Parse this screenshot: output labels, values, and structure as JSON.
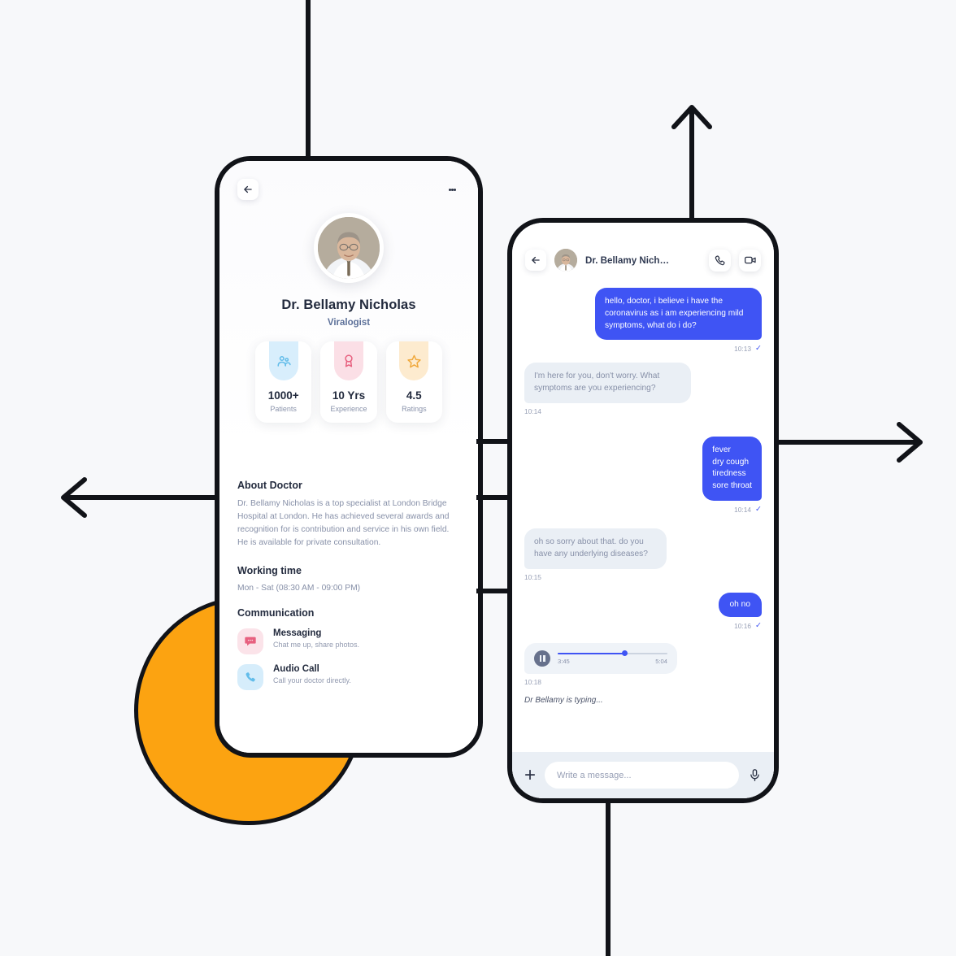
{
  "theme": {
    "background": "#f7f8fa",
    "outline": "#111318",
    "accent_blue": "#3f54f4",
    "accent_orange": "#fca311",
    "text_dark": "#232b3e",
    "text_muted": "#8790a8"
  },
  "decor": {
    "arrow_up": "arrow-up",
    "arrow_left": "arrow-left",
    "arrow_right": "arrow-right",
    "disc_shape": "pac-man-disc"
  },
  "profile_screen": {
    "back_icon": "arrow-left-icon",
    "menu_icon": "more-vertical-icon",
    "avatar": "doctor-portrait",
    "name": "Dr. Bellamy Nicholas",
    "role": "Viralogist",
    "stats": [
      {
        "icon": "people-icon",
        "icon_bg": "#d8eefc",
        "icon_color": "#63bdea",
        "value": "1000+",
        "label": "Patients"
      },
      {
        "icon": "award-icon",
        "icon_bg": "#fbdfe6",
        "icon_color": "#e7607f",
        "value": "10 Yrs",
        "label": "Experience"
      },
      {
        "icon": "star-icon",
        "icon_bg": "#fdebcf",
        "icon_color": "#f0a93d",
        "value": "4.5",
        "label": "Ratings"
      }
    ],
    "about_title": "About Doctor",
    "about_text": "Dr. Bellamy Nicholas is a top specialist at London Bridge Hospital at London. He has achieved several awards and recognition for is contribution and service in his own field. He is available for private consultation.",
    "working_title": "Working time",
    "working_text": "Mon - Sat (08:30 AM - 09:00 PM)",
    "communication_title": "Communication",
    "communication": [
      {
        "icon": "chat-bubble-icon",
        "icon_bg": "#fbe3e9",
        "icon_color": "#e7607f",
        "title": "Messaging",
        "desc": "Chat me up, share photos."
      },
      {
        "icon": "phone-icon",
        "icon_bg": "#d6edfb",
        "icon_color": "#63bdea",
        "title": "Audio Call",
        "desc": "Call your doctor directly."
      }
    ]
  },
  "chat_screen": {
    "back_icon": "arrow-left-icon",
    "avatar": "doctor-portrait",
    "contact_name": "Dr. Bellamy Nich…",
    "call_icon": "phone-icon",
    "video_icon": "video-camera-icon",
    "messages": [
      {
        "side": "out",
        "text": "hello, doctor, i believe i have the coronavirus as i am experiencing mild symptoms, what do i do?",
        "time": "10:13",
        "tick": "✓"
      },
      {
        "side": "in",
        "text": "I'm here for you, don't worry. What symptoms are you experiencing?",
        "time": "10:14",
        "tick": ""
      },
      {
        "side": "out",
        "text": "fever\ndry cough\ntiredness\nsore throat",
        "time": "10:14",
        "tick": "✓"
      },
      {
        "side": "in",
        "text": "oh so sorry about that. do you have any underlying diseases?",
        "time": "10:15",
        "tick": ""
      },
      {
        "side": "out",
        "text": "oh no",
        "time": "10:16",
        "tick": "✓"
      }
    ],
    "voice_message": {
      "play_icon": "pause-icon",
      "elapsed": "3:45",
      "duration": "5:04",
      "progress_percent": 61,
      "time": "10:18"
    },
    "typing_indicator": "Dr Bellamy is typing...",
    "composer": {
      "add_icon": "plus-icon",
      "placeholder": "Write a message...",
      "mic_icon": "microphone-icon"
    }
  }
}
